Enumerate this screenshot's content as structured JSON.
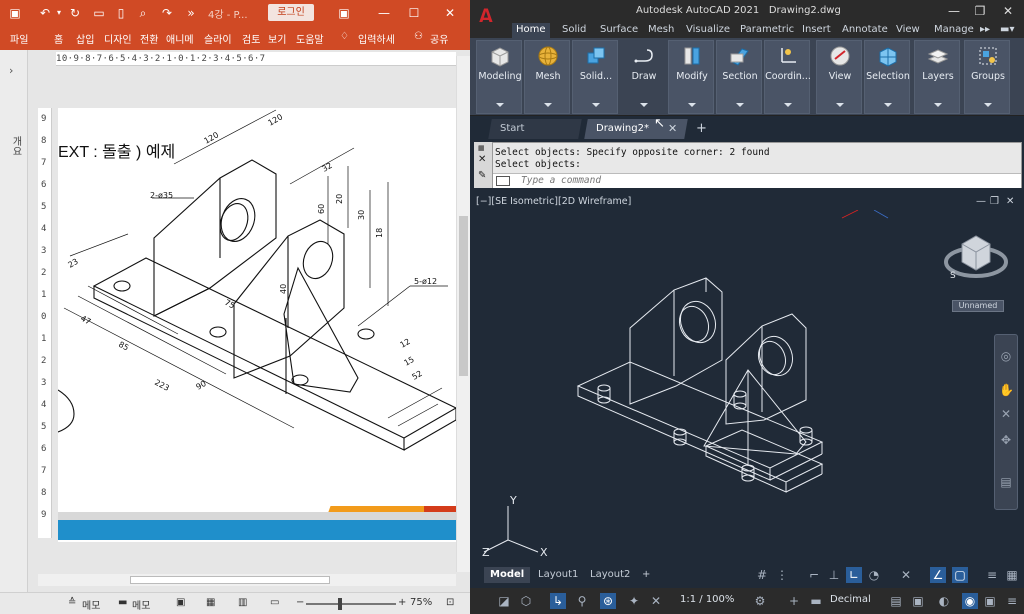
{
  "ppt": {
    "doc_title": "4강 - P...",
    "login_label": "로그인",
    "menu": [
      "파일",
      "홈",
      "삽입",
      "디자인",
      "전환",
      "애니메",
      "슬라이",
      "검토",
      "보기",
      "도움말",
      "입력하세",
      "공유"
    ],
    "collapsed_panel_label": "개요",
    "hruler_text": "10·9·8·7·6·5·4·3·2·1·0·1·2·3·4·5·6·7",
    "vruler": [
      "9",
      "8",
      "7",
      "6",
      "5",
      "4",
      "3",
      "2",
      "1",
      "0",
      "1",
      "2",
      "3",
      "4",
      "5",
      "6",
      "7",
      "8",
      "9"
    ],
    "slide": {
      "title": "EXT : 돌출 ) 예제",
      "dims": {
        "d120a": "120",
        "d120b": "120",
        "d2phi35": "2-ø35",
        "d5phi12": "5-ø12",
        "d32": "32",
        "d18": "18",
        "d30": "30",
        "d20": "20",
        "d60": "60",
        "d223": "223",
        "d23": "23",
        "d90": "90",
        "d85": "85",
        "d47": "47",
        "d75": "75",
        "d40": "40",
        "d12": "12",
        "d15": "15",
        "d52": "52"
      }
    },
    "status": {
      "notes": "메모",
      "comments": "메모",
      "zoom": "75%"
    }
  },
  "acad": {
    "app_title": "Autodesk AutoCAD 2021",
    "drawing_title": "Drawing2.dwg",
    "ribbon_tabs": [
      "Home",
      "Solid",
      "Surface",
      "Mesh",
      "Visualize",
      "Parametric",
      "Insert",
      "Annotate",
      "View",
      "Manage"
    ],
    "active_ribbon_tab": "Home",
    "ribbon_panels": [
      "Modeling",
      "Mesh",
      "Solid...",
      "Draw",
      "Modify",
      "Section",
      "Coordin...",
      "View",
      "Selection",
      "Layers",
      "Groups"
    ],
    "file_tabs": [
      "Start",
      "Drawing2*"
    ],
    "command_history": [
      "Select objects: Specify opposite corner: 2 found",
      "Select objects:"
    ],
    "command_placeholder": "Type a command",
    "viewport_label": "[−][SE Isometric][2D Wireframe]",
    "viewcube_label": "Unnamed",
    "ucs": {
      "y": "Y",
      "z": "Z",
      "x": "X"
    },
    "layout_tabs": [
      "Model",
      "Layout1",
      "Layout2"
    ],
    "status": {
      "scale": "1:1 / 100%",
      "units": "Decimal"
    },
    "colors": {
      "brand_red": "#d2262c",
      "viewport_bg": "#202a37",
      "ribbon_bg": "#3b4453"
    }
  },
  "colors": {
    "ppt_accent": "#d04a25",
    "slide_footer_blue": "#1f8fcb",
    "slide_footer_orange": "#f29b1b"
  }
}
